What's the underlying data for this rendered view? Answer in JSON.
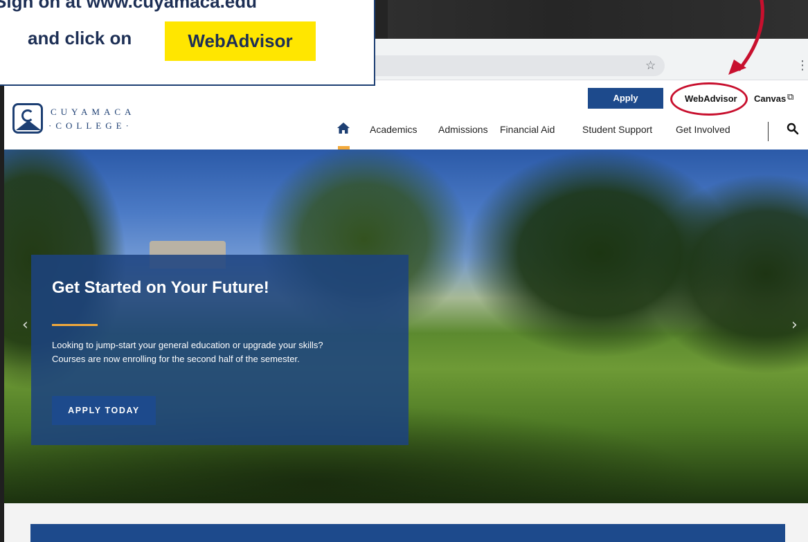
{
  "callout": {
    "line1": "Sign on at www.cuyamaca.edu",
    "line2": "and click on",
    "highlight": "WebAdvisor"
  },
  "browser": {
    "star_icon": "star-icon",
    "menu_icon": "kebab-menu-icon"
  },
  "site": {
    "logo_line1": "CUYAMACA",
    "logo_line2": "·COLLEGE·",
    "utility": {
      "apply_label": "Apply",
      "webadvisor_label": "WebAdvisor",
      "canvas_label": "Canvas"
    },
    "nav": {
      "items": [
        "Academics",
        "Admissions",
        "Financial Aid",
        "Student Support",
        "Get Involved"
      ]
    }
  },
  "hero": {
    "title": "Get Started on Your Future!",
    "body_line1": "Looking to jump-start your general education or upgrade your skills?",
    "body_line2": "Courses are now enrolling for the second half of the semester.",
    "button_label": "APPLY TODAY"
  },
  "colors": {
    "brand_blue": "#1d4a8c",
    "accent_gold": "#f2a93b",
    "annotation_red": "#c8102e",
    "highlight_yellow": "#ffe600"
  }
}
